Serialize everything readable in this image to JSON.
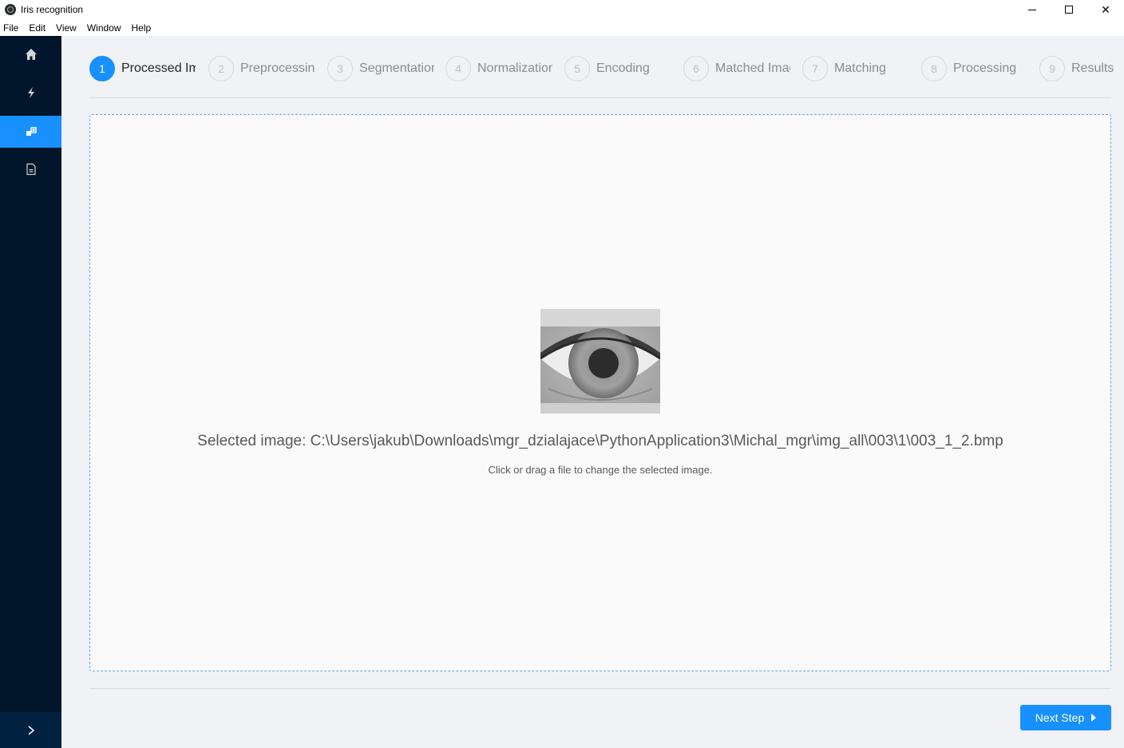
{
  "window": {
    "title": "Iris recognition",
    "minimize_icon": "minimize-icon",
    "maximize_icon": "maximize-icon",
    "close_glyph": "✕"
  },
  "menu": [
    "File",
    "Edit",
    "View",
    "Window",
    "Help"
  ],
  "sidebar": {
    "items": [
      {
        "icon": "home-icon",
        "active": false
      },
      {
        "icon": "lightning-icon",
        "active": false
      },
      {
        "icon": "blocks-icon",
        "active": true
      },
      {
        "icon": "file-icon",
        "active": false
      }
    ],
    "collapse_glyph": ">"
  },
  "steps": [
    {
      "number": "1",
      "label": "Processed Image",
      "active": true
    },
    {
      "number": "2",
      "label": "Preprocessing",
      "active": false
    },
    {
      "number": "3",
      "label": "Segmentation",
      "active": false
    },
    {
      "number": "4",
      "label": "Normalization",
      "active": false
    },
    {
      "number": "5",
      "label": "Encoding",
      "active": false
    },
    {
      "number": "6",
      "label": "Matched Image",
      "active": false
    },
    {
      "number": "7",
      "label": "Matching",
      "active": false
    },
    {
      "number": "8",
      "label": "Processing",
      "active": false
    },
    {
      "number": "9",
      "label": "Results",
      "active": false
    }
  ],
  "dropzone": {
    "selected_image_text": "Selected image: C:\\Users\\jakub\\Downloads\\mgr_dzialajace\\PythonApplication3\\Michal_mgr\\img_all\\003\\1\\003_1_2.bmp",
    "hint": "Click or drag a file to change the selected image."
  },
  "footer": {
    "next_label": "Next Step"
  },
  "colors": {
    "accent": "#1890ff",
    "sidebar_bg": "#001529"
  }
}
